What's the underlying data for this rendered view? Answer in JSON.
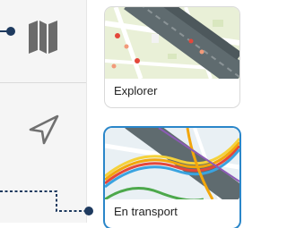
{
  "rail": {
    "items": [
      {
        "icon": "map-icon"
      },
      {
        "icon": "navigation-arrow-icon"
      }
    ]
  },
  "map_styles": [
    {
      "label": "Explorer",
      "selected": false
    },
    {
      "label": "En transport",
      "selected": true
    }
  ],
  "colors": {
    "accent": "#2a86c9",
    "callout": "#1e3a5f",
    "transit_lines": [
      "#e4473b",
      "#f2a60c",
      "#f5d23b",
      "#3aa3e0",
      "#4ca84b",
      "#8c5bb5"
    ]
  }
}
